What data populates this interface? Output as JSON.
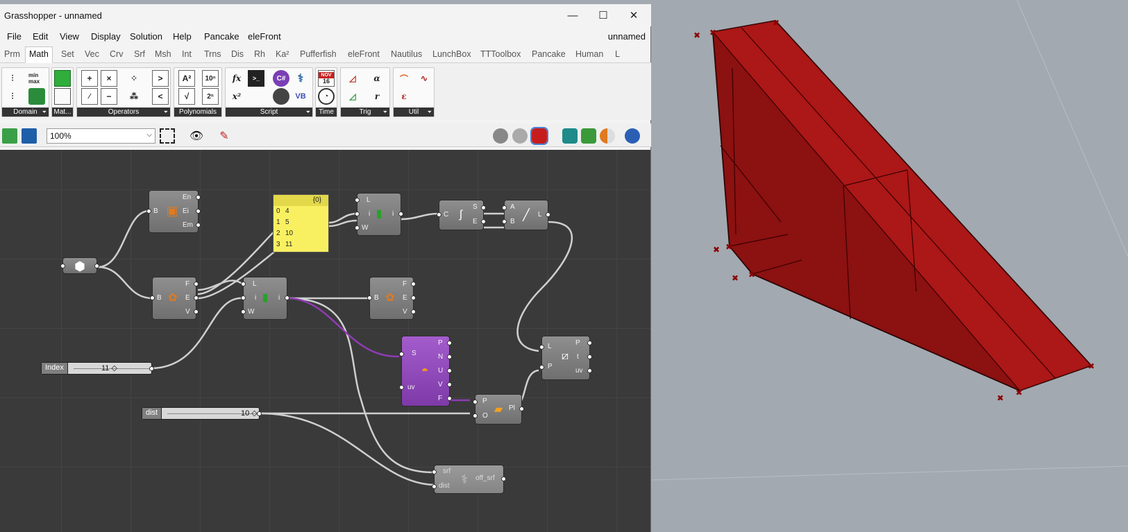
{
  "window": {
    "title": "Grasshopper - unnamed",
    "controls": {
      "minimize": "—",
      "maximize": "☐",
      "close": "✕"
    }
  },
  "menu": {
    "items": [
      "File",
      "Edit",
      "View",
      "Display",
      "Solution",
      "Help",
      "Pancake",
      "eleFront"
    ],
    "document_name": "unnamed"
  },
  "tabs": {
    "items": [
      "Prm",
      "Math",
      "Set",
      "Vec",
      "Crv",
      "Srf",
      "Msh",
      "Int",
      "Trns",
      "Dis",
      "Rh",
      "Ka²",
      "Pufferfish",
      "eleFront",
      "Nautilus",
      "LunchBox",
      "TTToolbox",
      "Pancake",
      "Human",
      "L"
    ],
    "active": "Math"
  },
  "ribbon": {
    "groups": [
      "Domain",
      "Mat...",
      "Operators",
      "Polynomials",
      "Script",
      "Time",
      "Trig",
      "Util"
    ],
    "group_arrow": "⏷",
    "calendar_month": "NOV",
    "calendar_day": "16"
  },
  "toolbar": {
    "zoom_value": "100%",
    "zoom_arrow": "⌵"
  },
  "canvas": {
    "deconstruct_brep_top": {
      "input": "B",
      "outputs": [
        "En",
        "Ei",
        "Em"
      ]
    },
    "brep_param": {
      "icon": "hexagon-icon"
    },
    "deconstruct_brep_mid": {
      "input": "B",
      "outputs": [
        "F",
        "E",
        "V"
      ]
    },
    "deconstruct_brep_right": {
      "input": "B",
      "outputs": [
        "F",
        "E",
        "V"
      ]
    },
    "panel": {
      "header": "{0}",
      "rows": [
        {
          "index": "0",
          "value": "4"
        },
        {
          "index": "1",
          "value": "5"
        },
        {
          "index": "2",
          "value": "10"
        },
        {
          "index": "3",
          "value": "11"
        }
      ]
    },
    "list_item_top": {
      "inputs": [
        "L",
        "i",
        "W"
      ],
      "output": "i"
    },
    "list_item_mid": {
      "inputs": [
        "L",
        "i",
        "W"
      ],
      "output": "i"
    },
    "curve_ends": {
      "input": "C",
      "outputs": [
        "S",
        "E"
      ]
    },
    "line": {
      "inputs": [
        "A",
        "B"
      ],
      "output": "L"
    },
    "evaluate_surface": {
      "inputs": [
        "S",
        "uv"
      ],
      "outputs": [
        "P",
        "N",
        "U",
        "V",
        "F"
      ]
    },
    "curve_closest_point": {
      "inputs": [
        "L",
        "P"
      ],
      "outputs": [
        "P",
        "t",
        "uv"
      ]
    },
    "move_plane": {
      "inputs": [
        "P",
        "O"
      ],
      "output": "Pl"
    },
    "python": {
      "inputs": [
        "srf",
        "dist"
      ],
      "output": "off_srf"
    },
    "index_slider": {
      "label": "Index",
      "value": "11 ◇"
    },
    "dist_slider": {
      "label": "dist",
      "value": "10 ◇"
    }
  },
  "colors": {
    "canvas_bg": "#3a3a3a",
    "component": "#7f7f7f",
    "panel": "#f9f061",
    "selected_wire": "#8e3cb4",
    "surface": "#a11515",
    "point_marker": "#8a0000"
  }
}
